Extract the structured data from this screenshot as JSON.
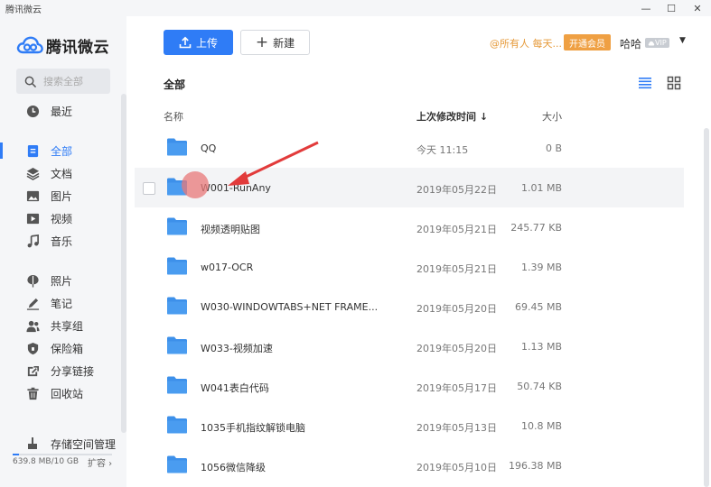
{
  "window": {
    "title": "腾讯微云",
    "minimize": "—",
    "maximize": "☐",
    "close": "✕"
  },
  "brand": {
    "name": "腾讯微云",
    "accent": "#2f7cf6"
  },
  "search": {
    "placeholder": "搜索全部"
  },
  "sidebar": {
    "items": [
      {
        "label": "最近",
        "icon": "clock-icon"
      },
      {
        "label": "全部",
        "icon": "file-icon",
        "active": true
      },
      {
        "label": "文档",
        "icon": "layers-icon"
      },
      {
        "label": "图片",
        "icon": "image-icon"
      },
      {
        "label": "视频",
        "icon": "video-icon"
      },
      {
        "label": "音乐",
        "icon": "music-icon"
      },
      {
        "label": "照片",
        "icon": "balloon-icon"
      },
      {
        "label": "笔记",
        "icon": "pen-icon"
      },
      {
        "label": "共享组",
        "icon": "group-icon"
      },
      {
        "label": "保险箱",
        "icon": "shield-icon"
      },
      {
        "label": "分享链接",
        "icon": "share-icon"
      },
      {
        "label": "回收站",
        "icon": "trash-icon"
      }
    ],
    "storage": {
      "label": "存储空间管理",
      "usage": "639.8 MB/10 GB",
      "used_fraction": 0.062,
      "expand": "扩容 ›"
    }
  },
  "toolbar": {
    "upload_label": "上传",
    "new_label": "新建",
    "marquee": "@所有人 每天...",
    "vip_button": "开通会员",
    "username": "哈哈",
    "vip_badge": "VIP",
    "caret": "▼"
  },
  "content": {
    "breadcrumb": "全部",
    "columns": {
      "name": "名称",
      "time": "上次修改时间 ↓",
      "size": "大小"
    },
    "files": [
      {
        "name": "QQ",
        "time": "今天 11:15",
        "size": "0 B"
      },
      {
        "name": "W001-RunAny",
        "time": "2019年05月22日",
        "size": "1.01 MB",
        "hover": true
      },
      {
        "name": "视频透明贴图",
        "time": "2019年05月21日",
        "size": "245.77 KB"
      },
      {
        "name": "w017-OCR",
        "time": "2019年05月21日",
        "size": "1.39 MB"
      },
      {
        "name": "W030-WINDOWTABS+NET FRAME...",
        "time": "2019年05月20日",
        "size": "69.45 MB"
      },
      {
        "name": "W033-视频加速",
        "time": "2019年05月20日",
        "size": "1.13 MB"
      },
      {
        "name": "W041表白代码",
        "time": "2019年05月17日",
        "size": "50.74 KB"
      },
      {
        "name": "1035手机指纹解锁电脑",
        "time": "2019年05月13日",
        "size": "10.8 MB"
      },
      {
        "name": "1056微信降级",
        "time": "2019年05月10日",
        "size": "196.38 MB"
      }
    ]
  }
}
